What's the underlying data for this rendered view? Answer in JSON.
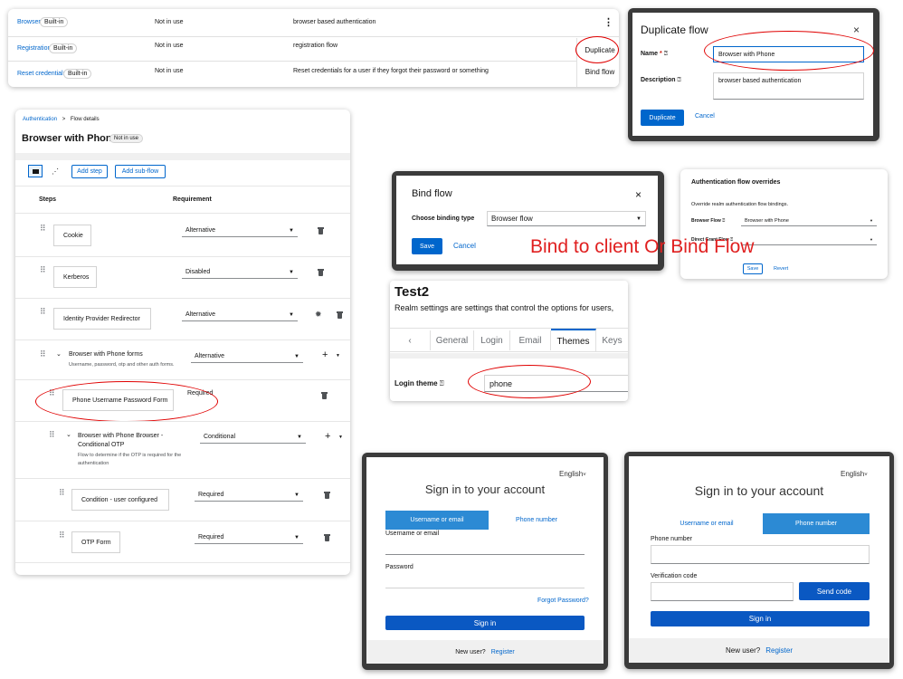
{
  "flows_table": {
    "rows": [
      {
        "name": "Browser",
        "badge": "Built-in",
        "status": "Not in use",
        "description": "browser based authentication",
        "action": "⋮"
      },
      {
        "name": "Registration",
        "badge": "Built-in",
        "status": "Not in use",
        "description": "registration flow",
        "action": "Duplicate"
      },
      {
        "name": "Reset credentials",
        "badge": "Built-in",
        "status": "Not in use",
        "description": "Reset credentials for a user if they forgot their password or something",
        "action": "Bind flow"
      }
    ]
  },
  "duplicate_modal": {
    "title": "Duplicate flow",
    "name_label": "Name",
    "name_required": "*",
    "name_value": "Browser with Phone",
    "description_label": "Description",
    "description_value": "browser based authentication",
    "duplicate_label": "Duplicate",
    "cancel_label": "Cancel",
    "close": "×"
  },
  "flow_details": {
    "breadcrumb_root": "Authentication",
    "breadcrumb_sep": ">",
    "breadcrumb_current": "Flow details",
    "title": "Browser with Phone",
    "status_badge": "Not in use",
    "add_step": "Add step",
    "add_subflow": "Add sub-flow",
    "col_steps": "Steps",
    "col_requirement": "Requirement",
    "steps": [
      {
        "name": "Cookie",
        "requirement": "Alternative"
      },
      {
        "name": "Kerberos",
        "requirement": "Disabled"
      },
      {
        "name": "Identity Provider Redirector",
        "requirement": "Alternative"
      }
    ],
    "subflow1": {
      "name": "Browser with Phone forms",
      "desc": "Username, password, otp and other auth forms.",
      "requirement": "Alternative"
    },
    "phone_form": {
      "name": "Phone Username Password Form",
      "requirement": "Required"
    },
    "subflow2": {
      "name_line1": "Browser with Phone Browser -",
      "name_line2": "Conditional OTP",
      "desc_line1": "Flow to determine if the OTP is required for the",
      "desc_line2": "authentication",
      "requirement": "Conditional"
    },
    "condition": {
      "name": "Condition - user configured",
      "requirement": "Required"
    },
    "otp": {
      "name": "OTP Form",
      "requirement": "Required"
    }
  },
  "bind_modal": {
    "title": "Bind flow",
    "close": "×",
    "binding_label": "Choose binding type",
    "binding_value": "Browser flow",
    "save": "Save",
    "cancel": "Cancel"
  },
  "annotation": {
    "text": "Bind to client Or Bind Flow",
    "color": "#e02020"
  },
  "overrides": {
    "title": "Authentication flow overrides",
    "subtitle": "Override realm authentication flow bindings.",
    "browser_label": "Browser Flow",
    "browser_value": "Browser with Phone",
    "direct_label": "Direct Grant Flow",
    "direct_value": "",
    "save": "Save",
    "revert": "Revert"
  },
  "realm": {
    "title": "Test2",
    "subtitle": "Realm settings are settings that control the options for users,",
    "tabs": [
      "General",
      "Login",
      "Email",
      "Themes",
      "Keys"
    ],
    "active_tab": "Themes",
    "login_theme_label": "Login theme",
    "login_theme_value": "phone"
  },
  "signin_left": {
    "language": "English",
    "title": "Sign in to your account",
    "tab_username": "Username or email",
    "tab_phone": "Phone number",
    "username_label": "Username or email",
    "password_label": "Password",
    "forgot": "Forgot Password?",
    "signin": "Sign in",
    "new_user": "New user?",
    "register": "Register"
  },
  "signin_right": {
    "language": "English",
    "title": "Sign in to your account",
    "tab_username": "Username or email",
    "tab_phone": "Phone number",
    "phone_label": "Phone number",
    "code_label": "Verification code",
    "send_code": "Send code",
    "signin": "Sign in",
    "new_user": "New user?",
    "register": "Register"
  },
  "colors": {
    "accent": "#0066cc",
    "highlight": "#e00000"
  }
}
